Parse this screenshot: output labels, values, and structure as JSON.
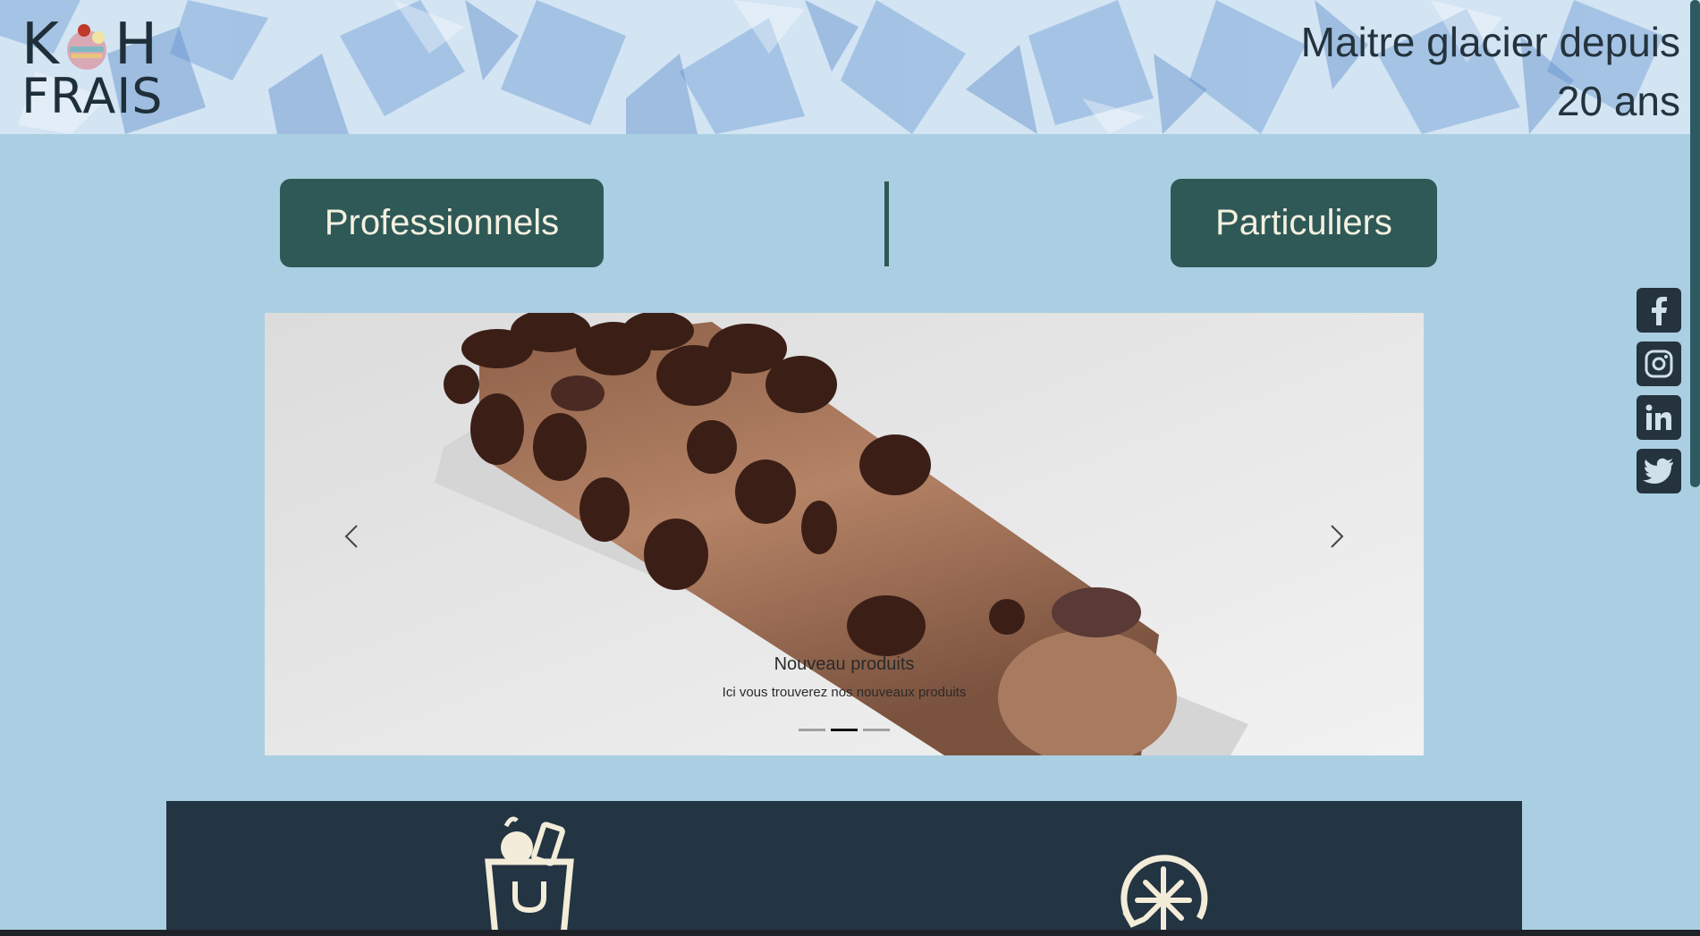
{
  "header": {
    "logo_line1_left": "K",
    "logo_line1_right": "H",
    "logo_line2": "FRAIS",
    "tagline_line1": "Maitre glacier depuis",
    "tagline_line2": "20 ans"
  },
  "nav": {
    "professionals_label": "Professionnels",
    "individuals_label": "Particuliers"
  },
  "carousel": {
    "caption_title": "Nouveau produits",
    "caption_text": "Ici vous trouverez nos nouveaux produits",
    "slide_count": 3,
    "active_slide": 2
  },
  "social": [
    "facebook-icon",
    "instagram-icon",
    "linkedin-icon",
    "twitter-icon"
  ],
  "colors": {
    "page_bg": "#abcfe2",
    "button_bg": "#2e5957",
    "button_text": "#f4f0e0",
    "band_bg": "#233442"
  }
}
